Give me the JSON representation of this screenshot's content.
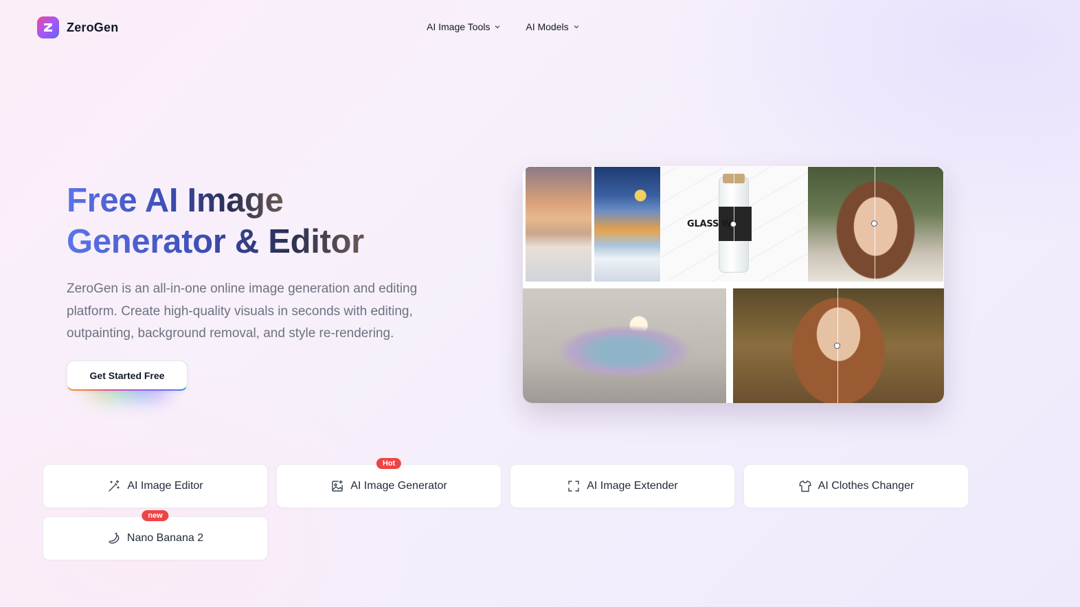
{
  "brand": {
    "name": "ZeroGen",
    "logo_letter": "Z"
  },
  "nav": [
    {
      "label": "AI Image Tools"
    },
    {
      "label": "AI Models"
    }
  ],
  "hero": {
    "title_line1": "Free AI Image",
    "title_line2": "Generator & Editor",
    "description": "ZeroGen is an all-in-one online image generation and editing platform. Create high-quality visuals in seconds with editing, outpainting, background removal, and style re-rendering.",
    "cta_label": "Get Started Free"
  },
  "showcase": {
    "bottle_text": "GLASS WA"
  },
  "tools": [
    {
      "label": "AI Image Editor",
      "icon": "magic-wand-icon",
      "badge": ""
    },
    {
      "label": "AI Image Generator",
      "icon": "image-plus-icon",
      "badge": "Hot"
    },
    {
      "label": "AI Image Extender",
      "icon": "expand-frame-icon",
      "badge": ""
    },
    {
      "label": "AI Clothes Changer",
      "icon": "shirt-icon",
      "badge": ""
    },
    {
      "label": "Nano Banana 2",
      "icon": "banana-icon",
      "badge": "new"
    }
  ],
  "colors": {
    "badge": "#ef4444",
    "title_gradient_start": "#5b74e8",
    "title_gradient_end": "#6b5a52"
  }
}
